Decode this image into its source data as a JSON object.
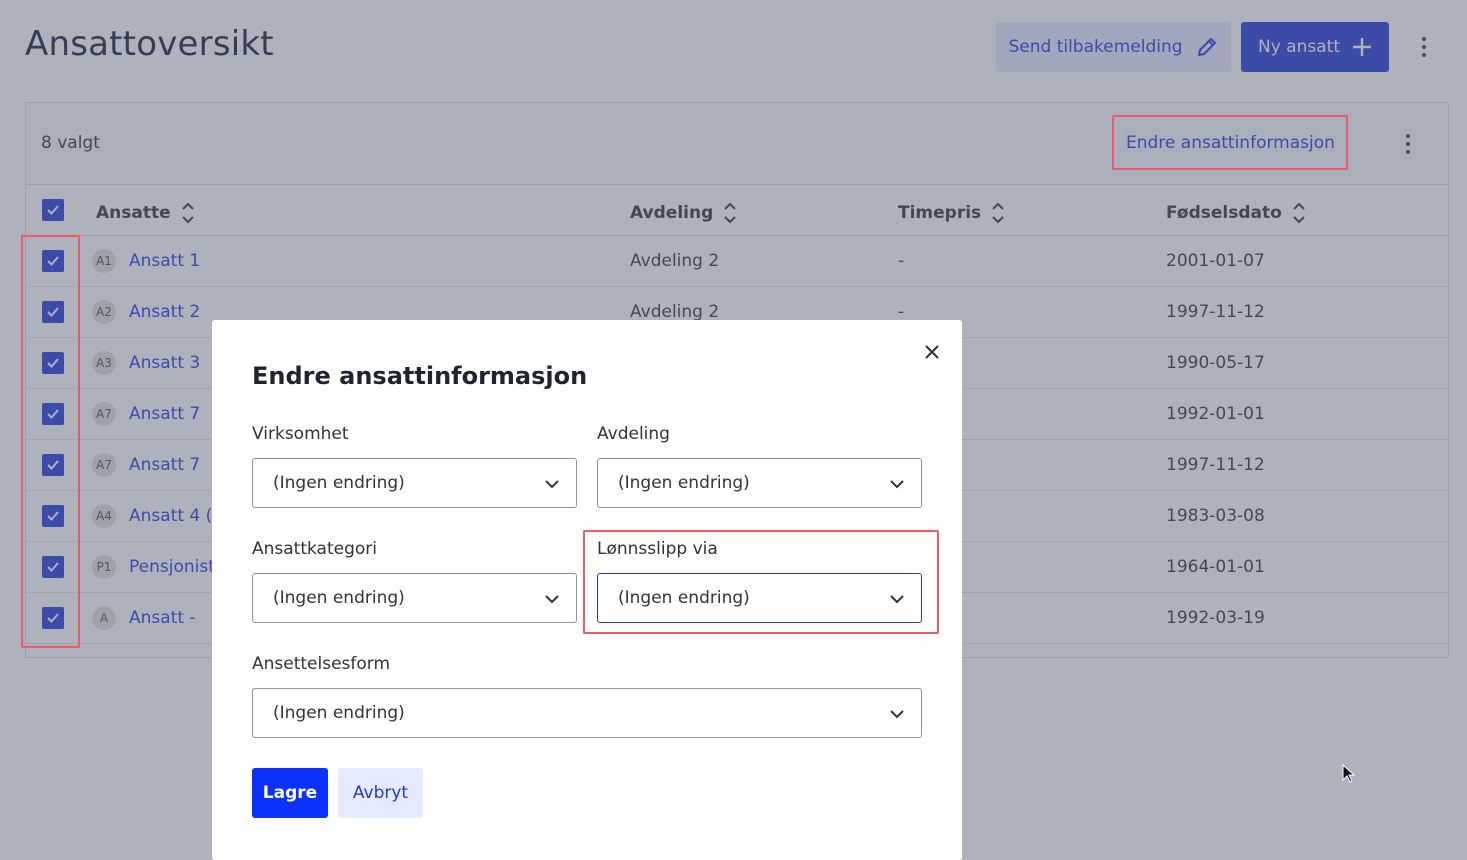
{
  "header": {
    "title": "Ansattoversikt",
    "feedback_label": "Send tilbakemelding",
    "new_employee_label": "Ny ansatt"
  },
  "table_bar": {
    "selected_count": "8 valgt",
    "edit_action": "Endre ansattinformasjon"
  },
  "columns": {
    "employees": "Ansatte",
    "department": "Avdeling",
    "hourly_rate": "Timepris",
    "birthdate": "Fødselsdato"
  },
  "rows": [
    {
      "initials": "A1",
      "name": "Ansatt 1",
      "department": "Avdeling 2",
      "rate": "-",
      "birthdate": "2001-01-07"
    },
    {
      "initials": "A2",
      "name": "Ansatt 2",
      "department": "Avdeling 2",
      "rate": "-",
      "birthdate": "1997-11-12"
    },
    {
      "initials": "A3",
      "name": "Ansatt 3",
      "department": "",
      "rate": "",
      "birthdate": "1990-05-17"
    },
    {
      "initials": "A7",
      "name": "Ansatt 7",
      "department": "",
      "rate": "",
      "birthdate": "1992-01-01"
    },
    {
      "initials": "A7",
      "name": "Ansatt 7",
      "department": "",
      "rate": "",
      "birthdate": "1997-11-12"
    },
    {
      "initials": "A4",
      "name": "Ansatt 4 (",
      "department": "",
      "rate": "",
      "birthdate": "1983-03-08"
    },
    {
      "initials": "P1",
      "name": "Pensjonist",
      "department": "",
      "rate": "",
      "birthdate": "1964-01-01"
    },
    {
      "initials": "A",
      "name": "Ansatt -",
      "department": "",
      "rate": "",
      "birthdate": "1992-03-19"
    }
  ],
  "modal": {
    "title": "Endre ansattinformasjon",
    "fields": {
      "company": {
        "label": "Virksomhet",
        "value": "(Ingen endring)"
      },
      "department": {
        "label": "Avdeling",
        "value": "(Ingen endring)"
      },
      "category": {
        "label": "Ansattkategori",
        "value": "(Ingen endring)"
      },
      "payslip": {
        "label": "Lønnsslipp via",
        "value": "(Ingen endring)"
      },
      "employment": {
        "label": "Ansettelsesform",
        "value": "(Ingen endring)"
      }
    },
    "save_label": "Lagre",
    "cancel_label": "Avbryt"
  },
  "colors": {
    "primary": "#2438d6",
    "highlight": "#ec5b68",
    "overlay": "#585f76"
  },
  "icons": [
    "pencil-icon",
    "plus-icon",
    "more-vertical-icon",
    "sort-icon",
    "check-icon",
    "close-icon",
    "chevron-down-icon",
    "mouse-cursor-icon"
  ]
}
